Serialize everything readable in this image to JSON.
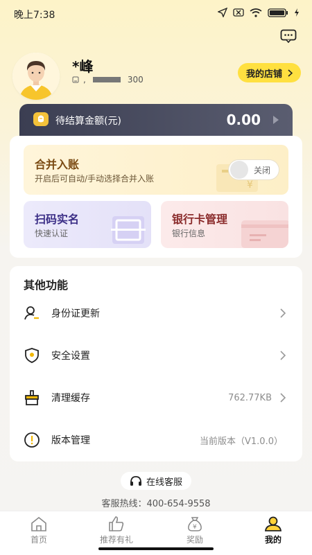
{
  "status_bar": {
    "time": "晚上7:38"
  },
  "profile": {
    "name": "*峰",
    "info_prefix": ",",
    "info_suffix": "300",
    "shop_button": "我的店铺"
  },
  "balance": {
    "label": "待结算金额(元)",
    "amount": "0.00"
  },
  "merge": {
    "title": "合并入账",
    "subtitle": "开启后可自动/手动选择合并入账",
    "toggle_label": "关闭",
    "toggle_on": false
  },
  "cards": {
    "scan": {
      "title": "扫码实名",
      "subtitle": "快速认证"
    },
    "bank": {
      "title": "银行卡管理",
      "subtitle": "银行信息"
    }
  },
  "other": {
    "title": "其他功能",
    "items": [
      {
        "label": "身份证更新",
        "value": "",
        "icon": "id-person-icon"
      },
      {
        "label": "安全设置",
        "value": "",
        "icon": "shield-icon"
      },
      {
        "label": "清理缓存",
        "value": "762.77KB",
        "icon": "broom-icon"
      },
      {
        "label": "版本管理",
        "value": "当前版本（V1.0.0）",
        "icon": "info-icon"
      }
    ]
  },
  "service": {
    "button": "在线客服",
    "hotline": "客服热线：400-654-9558"
  },
  "tabs": [
    {
      "label": "首页",
      "icon": "home-icon",
      "active": false
    },
    {
      "label": "推荐有礼",
      "icon": "thumb-up-icon",
      "active": false
    },
    {
      "label": "奖励",
      "icon": "money-bag-icon",
      "active": false
    },
    {
      "label": "我的",
      "icon": "user-icon",
      "active": true
    }
  ],
  "colors": {
    "accent_yellow": "#FFE040",
    "balance_dark": "#3B3E52",
    "merge_title": "#7A4A12"
  }
}
